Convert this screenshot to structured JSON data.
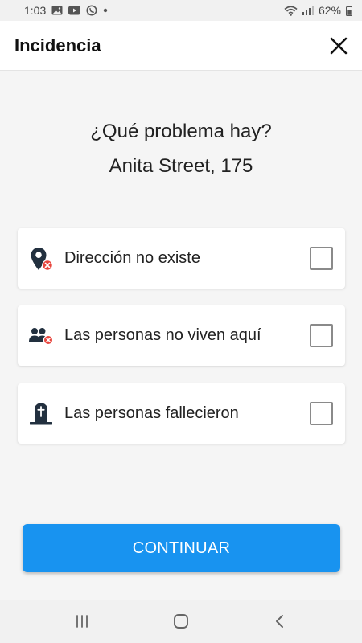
{
  "status_bar": {
    "time": "1:03",
    "battery": "62%",
    "icons": [
      "gallery-icon",
      "youtube-icon",
      "whatsapp-icon",
      "dot-icon",
      "wifi-icon",
      "signal-icon",
      "battery-icon"
    ]
  },
  "header": {
    "title": "Incidencia",
    "close_icon": "close-icon"
  },
  "main": {
    "question": "¿Qué problema hay?",
    "address": "Anita Street, 175",
    "options": [
      {
        "label": "Dirección no existe",
        "icon": "location-error-icon",
        "checked": false
      },
      {
        "label": "Las personas no viven aquí",
        "icon": "people-error-icon",
        "checked": false
      },
      {
        "label": "Las personas fallecieron",
        "icon": "gravestone-icon",
        "checked": false
      }
    ]
  },
  "footer": {
    "continue_label": "CONTINUAR"
  },
  "nav_bar": {
    "icons": [
      "recent-apps-icon",
      "home-icon",
      "back-icon"
    ]
  },
  "colors": {
    "accent": "#1893f0",
    "icon_dark": "#22303f",
    "error_red": "#e8463e",
    "background": "#f5f5f5"
  }
}
